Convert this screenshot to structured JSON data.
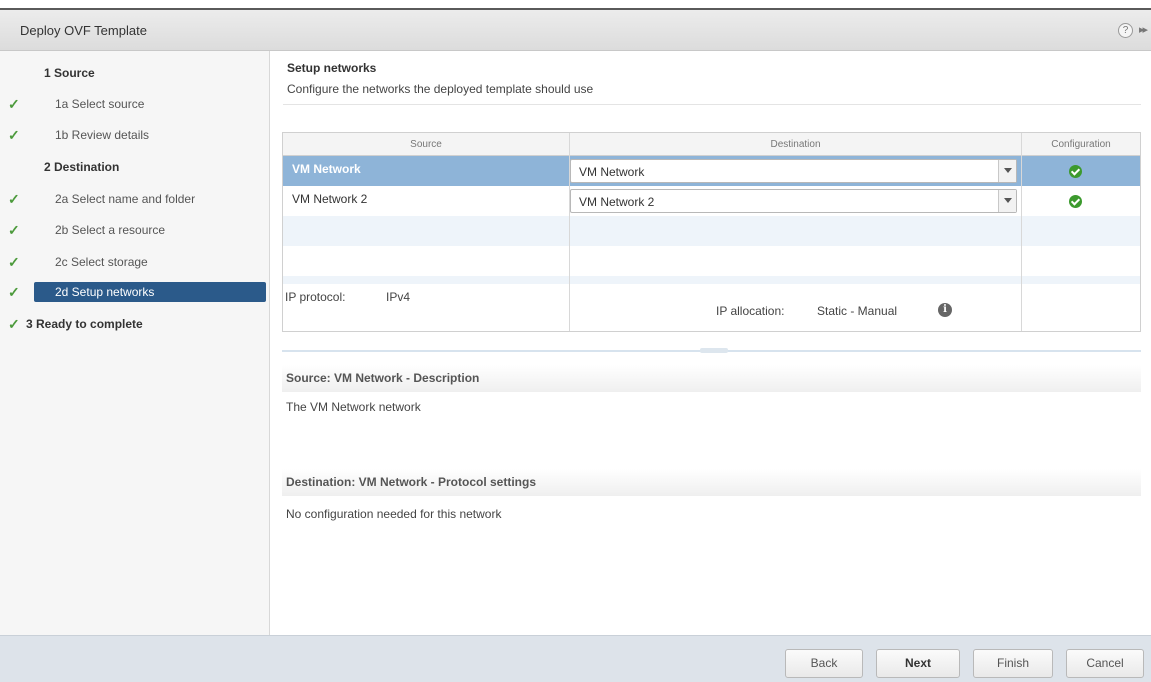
{
  "window": {
    "title": "Deploy OVF Template",
    "help_icon": "?",
    "expand_icon": "▸▸"
  },
  "sidebar": {
    "steps": [
      {
        "label": "1 Source",
        "done": false,
        "group": true
      },
      {
        "label": "1a  Select source",
        "done": true
      },
      {
        "label": "1b  Review details",
        "done": true
      },
      {
        "label": "2 Destination",
        "done": false,
        "group": true
      },
      {
        "label": "2a  Select name and folder",
        "done": true
      },
      {
        "label": "2b  Select a resource",
        "done": true
      },
      {
        "label": "2c  Select storage",
        "done": true
      },
      {
        "label": "2d  Setup networks",
        "done": true,
        "active": true
      },
      {
        "label": "3  Ready to complete",
        "done": true,
        "group": true
      }
    ],
    "check_glyph": "✓"
  },
  "main": {
    "title": "Setup networks",
    "subtitle": "Configure the networks the deployed template should use",
    "table": {
      "columns": [
        "Source",
        "Destination",
        "Configuration"
      ],
      "rows": [
        {
          "source": "VM Network",
          "destination": "VM Network",
          "configured": true,
          "selected": true
        },
        {
          "source": "VM Network 2",
          "destination": "VM Network 2",
          "configured": true,
          "selected": false
        }
      ]
    },
    "ip_protocol_label": "IP protocol:",
    "ip_protocol_value": "IPv4",
    "ip_allocation_label": "IP allocation:",
    "ip_allocation_value": "Static - Manual",
    "info_icon": "i",
    "source_section_title": "Source: VM Network - Description",
    "source_description": "The VM Network network",
    "dest_section_title": "Destination: VM Network - Protocol settings",
    "dest_description": "No configuration needed for this network"
  },
  "footer": {
    "back": "Back",
    "next": "Next",
    "finish": "Finish",
    "cancel": "Cancel"
  },
  "colors": {
    "accent": "#2b5a8a",
    "selected_row": "#8eb4d8",
    "check": "#4c9a3c"
  }
}
